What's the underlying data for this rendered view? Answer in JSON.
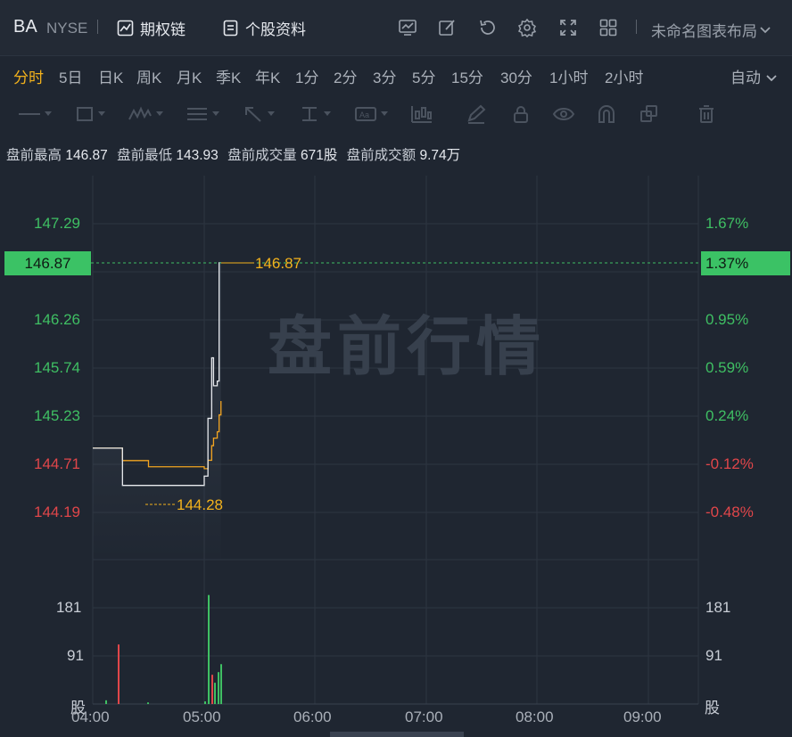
{
  "header": {
    "symbol": "BA",
    "exchange": "NYSE",
    "options_chain": "期权链",
    "stock_profile": "个股资料",
    "layout_label": "未命名图表布局"
  },
  "periods": {
    "items": [
      "分时",
      "5日",
      "日K",
      "周K",
      "月K",
      "季K",
      "年K",
      "1分",
      "2分",
      "3分",
      "5分",
      "15分",
      "30分",
      "1小时",
      "2小时"
    ],
    "active": "分时",
    "auto_label": "自动"
  },
  "stats": {
    "high_label": "盘前最高",
    "high_value": "146.87",
    "low_label": "盘前最低",
    "low_value": "143.93",
    "vol_label": "盘前成交量",
    "vol_value": "671股",
    "amt_label": "盘前成交额",
    "amt_value": "9.74万"
  },
  "chart": {
    "watermark": "盘前行情",
    "price_ticks": [
      {
        "price": "147.29",
        "pct": "1.67%",
        "dir": "up"
      },
      {
        "price": "146.26",
        "pct": "0.95%",
        "dir": "up"
      },
      {
        "price": "145.74",
        "pct": "0.59%",
        "dir": "up"
      },
      {
        "price": "145.23",
        "pct": "0.24%",
        "dir": "up"
      },
      {
        "price": "144.71",
        "pct": "-0.12%",
        "dir": "down"
      },
      {
        "price": "144.19",
        "pct": "-0.48%",
        "dir": "down"
      }
    ],
    "last_price_tag": "146.87",
    "last_pct_tag": "1.37%",
    "high_marker": "146.87",
    "low_marker": "144.28",
    "volume_ticks": [
      "181",
      "91"
    ],
    "volume_unit": "股",
    "x_labels": [
      "04:00",
      "05:00",
      "06:00",
      "07:00",
      "08:00",
      "09:00"
    ],
    "colors": {
      "up": "#3fbf63",
      "down": "#e0464a",
      "avg": "#f3a521",
      "price": "#e8eaee",
      "accent": "#f3b21c"
    }
  },
  "chart_data": {
    "type": "line",
    "title": "",
    "xlabel": "",
    "ylabel": "",
    "ylim": [
      143.93,
      147.55
    ],
    "x": [
      "04:00",
      "04:12",
      "04:16",
      "04:30",
      "05:00",
      "05:02",
      "05:04",
      "05:05",
      "05:07",
      "05:08",
      "05:09"
    ],
    "series": [
      {
        "values": [
          144.88,
          144.88,
          144.48,
          144.48,
          144.58,
          145.2,
          145.85,
          145.55,
          145.6,
          146.87,
          146.87
        ]
      }
    ],
    "volume": {
      "values_approx": [
        7,
        112,
        3,
        5,
        205,
        55,
        40,
        60,
        75,
        45
      ]
    }
  }
}
